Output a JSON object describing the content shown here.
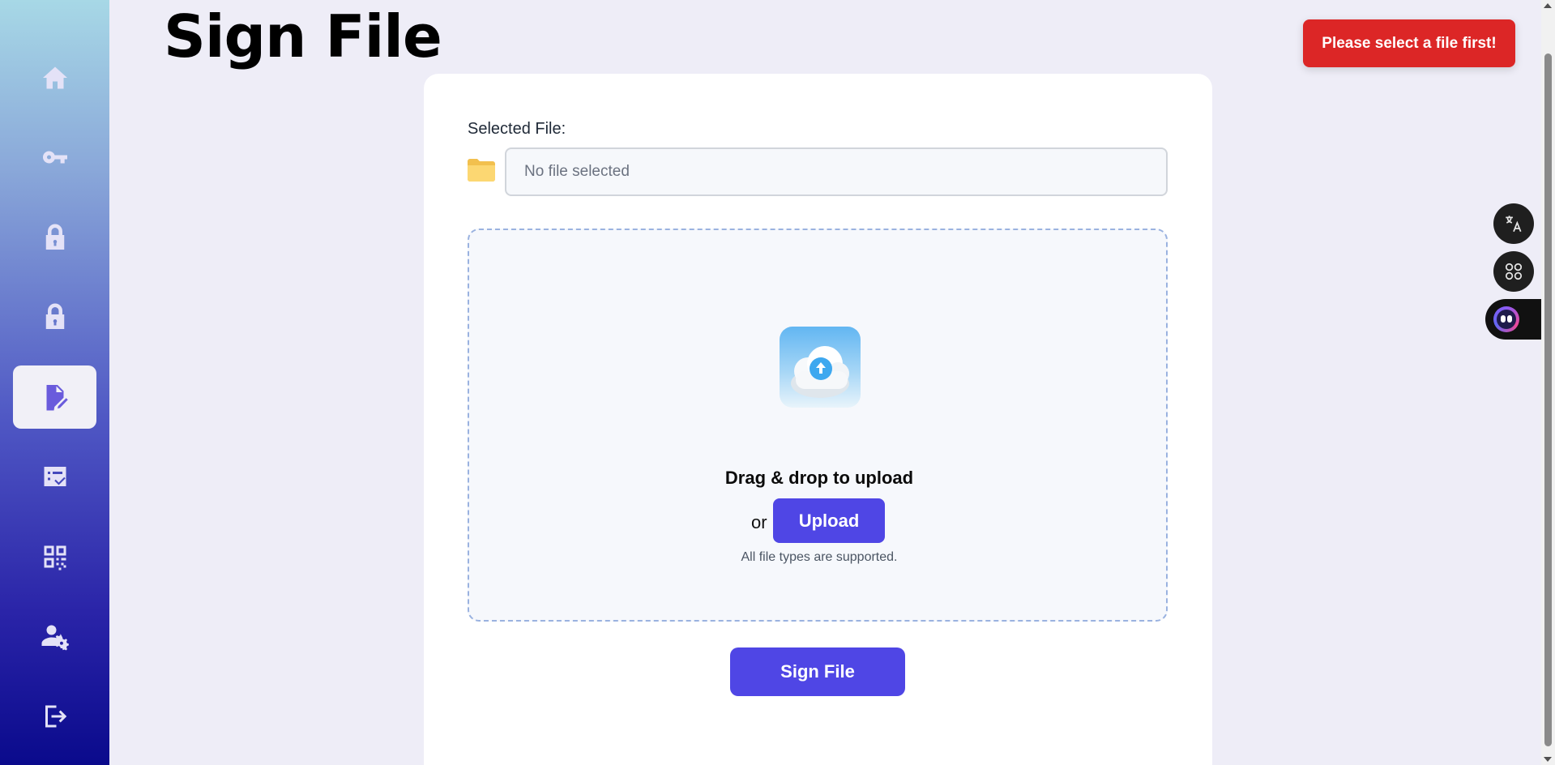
{
  "page": {
    "title": "Sign File"
  },
  "sidebar": {
    "items": [
      {
        "icon": "home-icon",
        "active": false
      },
      {
        "icon": "key-icon",
        "active": false
      },
      {
        "icon": "lock-icon",
        "active": false
      },
      {
        "icon": "unlock-icon",
        "active": false
      },
      {
        "icon": "sign-file-icon",
        "active": true
      },
      {
        "icon": "verify-icon",
        "active": false
      },
      {
        "icon": "qr-code-icon",
        "active": false
      },
      {
        "icon": "user-settings-icon",
        "active": false
      },
      {
        "icon": "logout-icon",
        "active": false
      }
    ]
  },
  "toast": {
    "message": "Please select a file first!",
    "color": "#dc2626"
  },
  "form": {
    "file_label": "Selected File:",
    "file_placeholder": "No file selected",
    "file_value": ""
  },
  "dropzone": {
    "title": "Drag & drop to upload",
    "or_text": "or",
    "upload_label": "Upload",
    "support_text": "All file types are supported."
  },
  "actions": {
    "sign_label": "Sign File"
  },
  "floating": {
    "translate_icon": "translate-icon",
    "apps_icon": "apps-icon",
    "assistant_icon": "assistant-icon"
  },
  "colors": {
    "accent": "#4f46e5",
    "error": "#dc2626"
  }
}
